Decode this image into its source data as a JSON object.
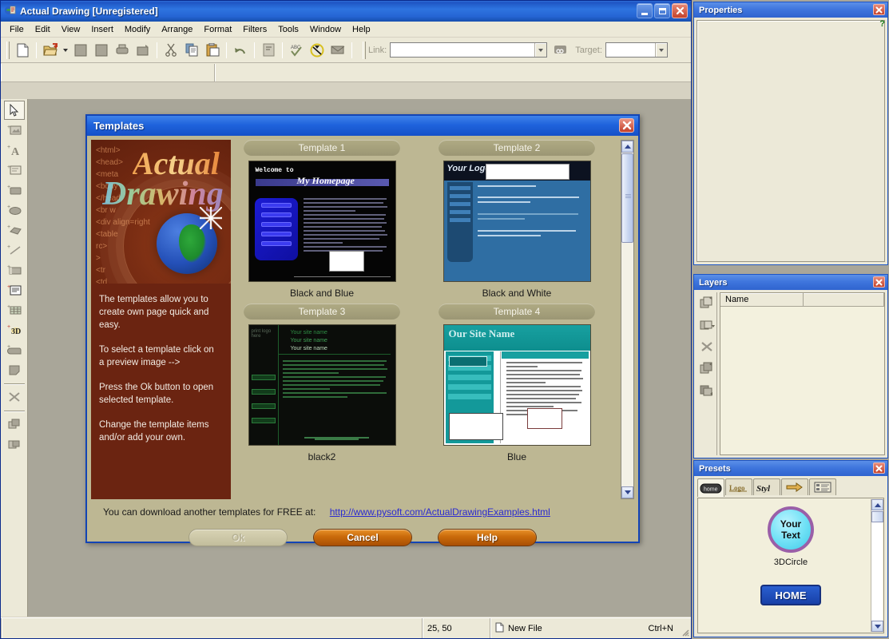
{
  "window": {
    "title": "Actual Drawing [Unregistered]",
    "app_icon": "actual-drawing-icon",
    "minimize": "–",
    "maximize": "□",
    "close": "✕"
  },
  "menubar": {
    "items": [
      "File",
      "Edit",
      "View",
      "Insert",
      "Modify",
      "Arrange",
      "Format",
      "Filters",
      "Tools",
      "Window",
      "Help"
    ]
  },
  "toolbar": {
    "buttons": [
      "new-file-icon",
      "open-file-icon",
      "save-icon",
      "save-all-icon",
      "print-icon",
      "print-preview-icon",
      "cut-icon",
      "copy-icon",
      "paste-icon",
      "undo-icon",
      "properties-icon",
      "spell-check-icon",
      "preview-browser-icon",
      "publish-icon"
    ],
    "link_label": "Link:",
    "link_value": "",
    "target_label": "Target:",
    "target_value": "",
    "insert_link_icon": "link-chain-icon"
  },
  "tools": {
    "items": [
      "pointer-tool",
      "image-tool",
      "text-tool",
      "form-tool",
      "rectangle-tool",
      "ellipse-tool",
      "polygon-tool",
      "line-tool",
      "button-tool",
      "applet-tool",
      "table-tool",
      "3d-text-tool",
      "rollover-tool",
      "shape-tool",
      "slice-tool",
      "new-layer-tool",
      "duplicate-layer-tool"
    ],
    "selected": "pointer-tool"
  },
  "statusbar": {
    "coordinates": "25, 50",
    "hint_icon": "new-file-icon",
    "hint_text": "New File",
    "shortcut": "Ctrl+N"
  },
  "docks": [
    {
      "title": "Properties",
      "close": "✕",
      "help_glyph": "?"
    },
    {
      "title": "Layers",
      "close": "✕",
      "column_headers": [
        "Name",
        ""
      ],
      "rows": [],
      "tool_icons": [
        "new-layer-icon",
        "duplicate-layer-icon",
        "delete-layer-icon",
        "move-up-layer-icon",
        "move-down-layer-icon"
      ]
    },
    {
      "title": "Presets",
      "close": "✕",
      "tabs": [
        "home-button-preset-tab",
        "logo-preset-tab",
        "style-preset-tab",
        "arrow-preset-tab",
        "list-preset-tab"
      ],
      "active_tab": 0,
      "items": [
        {
          "label": "3DCircle",
          "preview_text_line1": "Your",
          "preview_text_line2": "Text"
        },
        {
          "label": "",
          "preview_text_line1": "HOME",
          "preview_text_line2": ""
        }
      ]
    }
  ],
  "dialog": {
    "title": "Templates",
    "close": "✕",
    "info_paragraphs": [
      "The templates allow you to create own page quick and easy.",
      "To select a template click on a preview image -->",
      "Press the Ok button to open selected template.",
      "Change the template items and/or add your own."
    ],
    "logo": {
      "word1": "Actual",
      "word2": "Drawing",
      "code_lines": "<html>\n<head>\n<meta \n<body \n</head\n<br w\n<div align=right\n<table\nrc>\n>\n<tr\n<td\n</tr\n</t"
    },
    "templates": [
      {
        "header": "Template 1",
        "caption": "Black and Blue",
        "preview": {
          "title_small": "Welcome to",
          "title_big": "My Homepage",
          "nav": [
            "ACCESS LINK",
            "HOME",
            "CONTACT",
            "RESOURCE",
            "LINKS"
          ]
        }
      },
      {
        "header": "Template 2",
        "caption": "Black and White",
        "preview": {
          "logo_text": "Your Logo",
          "heading": "Welcome to our web site!"
        }
      },
      {
        "header": "Template 3",
        "caption": "black2",
        "preview": {
          "site_name": "Your site name"
        }
      },
      {
        "header": "Template 4",
        "caption": "Blue",
        "preview": {
          "site_name": "Our Site Name"
        }
      }
    ],
    "download_text": "You can download another templates for FREE at:",
    "download_link": "http://www.pysoft.com/ActualDrawingExamples.html",
    "buttons": [
      {
        "label": "Ok",
        "state": "disabled"
      },
      {
        "label": "Cancel",
        "state": "enabled"
      },
      {
        "label": "Help",
        "state": "enabled"
      }
    ],
    "scrollbar": {
      "up": "▲",
      "down": "▼"
    }
  },
  "colors": {
    "title_blue": "#1f63dc",
    "dialog_bg": "#bdb793",
    "accent_orange": "#c96a0a",
    "app_bg": "#a9a699",
    "panel_bg": "#ece9d8"
  }
}
